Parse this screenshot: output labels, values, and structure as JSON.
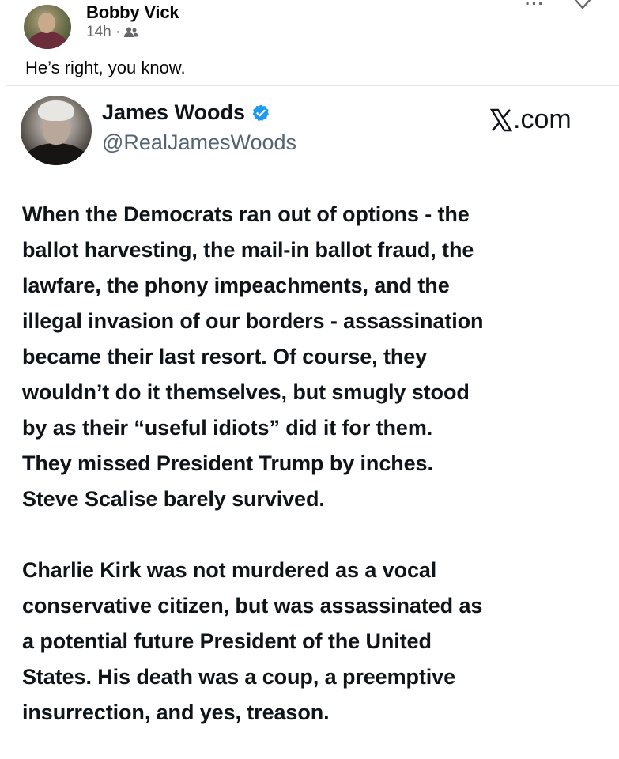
{
  "facebook_post": {
    "author_name": "Bobby Vick",
    "timestamp": "14h ·",
    "audience_icon": "friends-icon",
    "caption": "He’s right, you know.",
    "more_icon": "more-options-icon",
    "close_icon": "close-icon"
  },
  "embedded_tweet": {
    "display_name": "James Woods",
    "handle": "@RealJamesWoods",
    "verified": true,
    "verified_color": "#1d9bf0",
    "brand": ".com",
    "brand_logo": "x-logo-icon",
    "paragraphs": [
      [
        "When the Democrats ran out of options - the",
        "ballot harvesting, the mail-in ballot fraud, the",
        "lawfare, the phony impeachments, and the",
        "illegal invasion of our borders - assassination",
        "became their last resort. Of course, they",
        "wouldn’t do it themselves, but smugly stood",
        "by as their “useful idiots” did it for them.",
        "They missed President Trump by inches.",
        "Steve Scalise barely survived."
      ],
      [
        "Charlie Kirk was not murdered as a vocal",
        "conservative citizen, but was assassinated as",
        "a potential future President of the United",
        "States. His death was a coup, a preemptive",
        "insurrection, and yes, treason."
      ]
    ]
  },
  "colors": {
    "text_primary": "#050505",
    "text_secondary": "#65676b",
    "tweet_text": "#0f1419",
    "tweet_handle": "#536471"
  }
}
